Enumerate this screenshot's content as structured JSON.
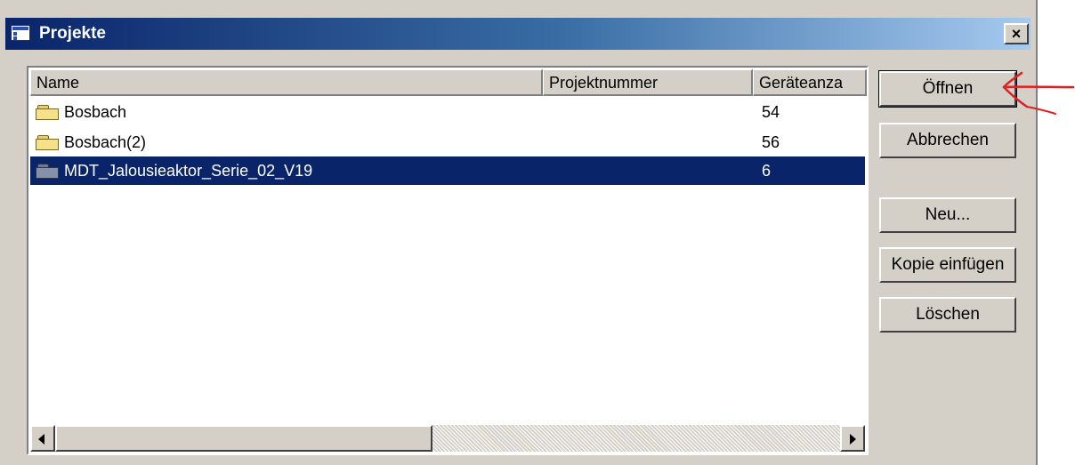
{
  "window": {
    "title": "Projekte",
    "close_label": "×"
  },
  "list": {
    "columns": [
      "Name",
      "Projektnummer",
      "Geräteanza"
    ],
    "rows": [
      {
        "name": "Bosbach",
        "projektnummer": "",
        "geraeteanzahl": "54",
        "selected": false
      },
      {
        "name": "Bosbach(2)",
        "projektnummer": "",
        "geraeteanzahl": "56",
        "selected": false
      },
      {
        "name": "MDT_Jalousieaktor_Serie_02_V19",
        "projektnummer": "",
        "geraeteanzahl": "6",
        "selected": true
      }
    ]
  },
  "buttons": {
    "open": "Öffnen",
    "cancel": "Abbrechen",
    "new": "Neu...",
    "paste_copy": "Kopie einfügen",
    "delete": "Löschen"
  },
  "icons": {
    "row_icon": "folder-icon",
    "app_icon": "window-icon"
  },
  "colors": {
    "selection": "#0a246a",
    "annotation": "#e02020",
    "titlebar_start": "#0a246a"
  }
}
